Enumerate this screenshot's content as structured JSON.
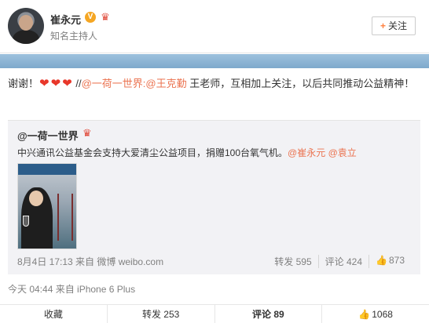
{
  "header": {
    "name": "崔永元",
    "vip_badge": "V",
    "subtitle": "知名主持人",
    "follow_label": "关注",
    "follow_icon": "+"
  },
  "post": {
    "prefix": "谢谢！",
    "hearts": [
      "❤",
      "❤",
      "❤"
    ],
    "sep": " //",
    "mention1": "@一荷一世界",
    "colon": ":",
    "mention2": "@王克勤",
    "body": " 王老师，互相加上关注，以后共同推动公益精神！",
    "meta": "今天 04:44 来自 iPhone 6 Plus"
  },
  "retweet": {
    "author": "@一荷一世界",
    "text_plain": "中兴通讯公益基金会支持大爱清尘公益项目，捐赠100台氧气机。",
    "mention_a": "@崔永元",
    "mention_b": "@袁立",
    "meta": "8月4日 17:13 来自 微博 weibo.com",
    "repost": "转发 595",
    "comment": "评论 424",
    "like_count": "873"
  },
  "footer": {
    "collect": "收藏",
    "repost": "转发 253",
    "comment": "评论 89",
    "like_count": "1068"
  },
  "colors": {
    "link": "#eb7350",
    "heart": "#e8372a",
    "accent": "#ff8140",
    "bar": "#8fb6d6"
  }
}
